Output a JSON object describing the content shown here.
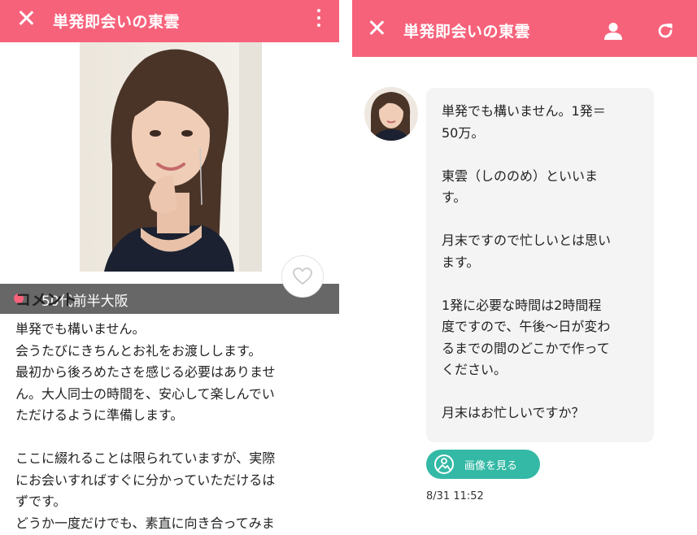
{
  "left": {
    "header": {
      "title": "単発即会いの東雲"
    },
    "profile": {
      "location": "50代前半大阪"
    },
    "comment": {
      "heading": "コメント",
      "lines": [
        "単発でも構いません。",
        "会うたびにきちんとお礼をお渡しします。",
        "最初から後ろめたさを感じる必要はありませ",
        "ん。大人同士の時間を、安心して楽しんでい",
        "ただけるように準備します。",
        "",
        "ここに綴れることは限られていますが、実際",
        "にお会いすればすぐに分かっていただけるは",
        "ずです。",
        "どうか一度だけでも、素直に向き合ってみま"
      ]
    }
  },
  "right": {
    "header": {
      "title": "単発即会いの東雲"
    },
    "message": {
      "lines": [
        "単発でも構いません。1発＝",
        "50万。",
        "",
        "東雲（しののめ）といいま",
        "す。",
        "",
        "月末ですので忙しいとは思い",
        "ます。",
        "",
        "1発に必要な時間は2時間程",
        "度ですので、午後〜日が変わ",
        "るまでの間のどこかで作って",
        "ください。",
        "",
        "月末はお忙しいですか？"
      ],
      "image_button_label": "画像を見る",
      "timestamp": "8/31 11:52"
    }
  },
  "colors": {
    "accent": "#f7627b",
    "button_teal": "#33b9a5",
    "bubble": "#f4f4f4"
  },
  "icons": [
    "close-icon",
    "more-vert-icon",
    "heart-icon",
    "person-icon",
    "refresh-icon",
    "image-icon"
  ]
}
